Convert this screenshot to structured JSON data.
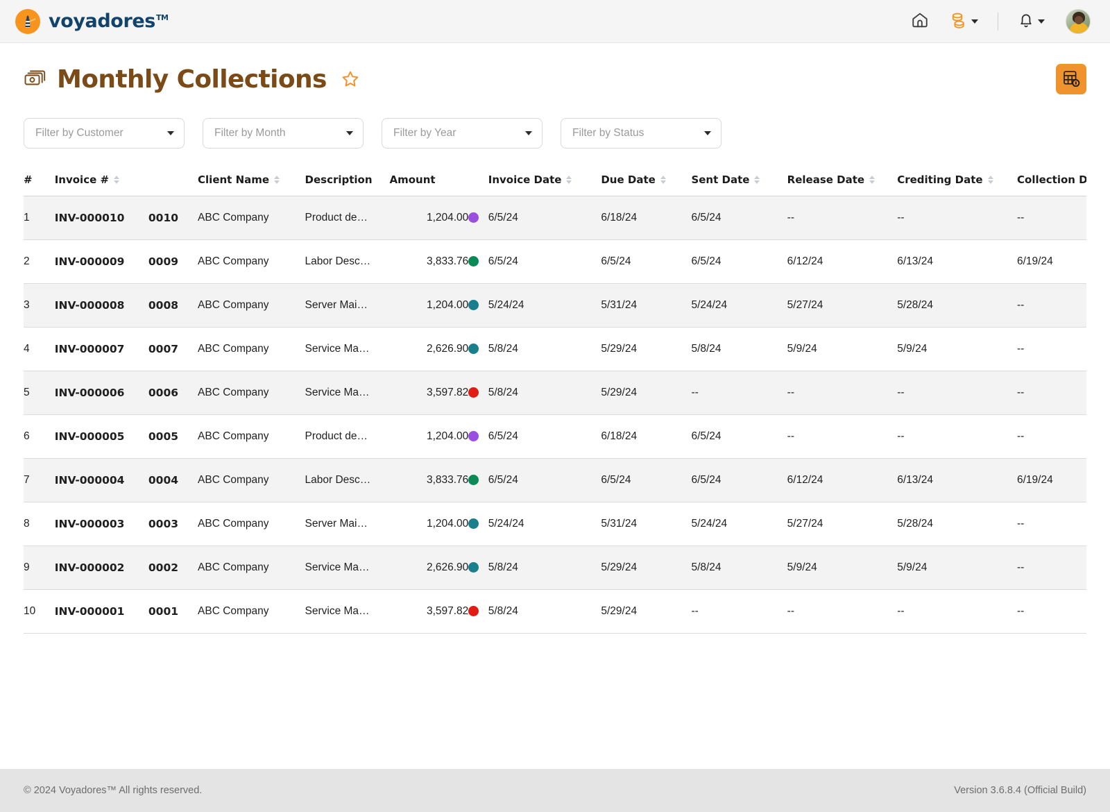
{
  "brand": {
    "name": "voyadores",
    "tm": "TM",
    "logo_icon": "lighthouse-icon",
    "accent_color": "#F7941D",
    "wordmark_color": "#12436B"
  },
  "topnav": {
    "home_icon": "home-icon",
    "billing_icon": "coins-stack-icon",
    "notifications_icon": "bell-icon",
    "avatar_icon": "user-avatar"
  },
  "header": {
    "title": "Monthly Collections",
    "title_icon": "money-bills-icon",
    "favorite_icon": "star-icon",
    "title_color": "#7A4A17",
    "action_button_icon": "calculator-money-icon",
    "action_button_color": "#F1932C"
  },
  "filters": [
    {
      "name": "customer",
      "placeholder": "Filter by Customer",
      "value": ""
    },
    {
      "name": "month",
      "placeholder": "Filter by Month",
      "value": ""
    },
    {
      "name": "year",
      "placeholder": "Filter by Year",
      "value": ""
    },
    {
      "name": "status",
      "placeholder": "Filter by Status",
      "value": ""
    }
  ],
  "table": {
    "columns": [
      {
        "key": "num",
        "label": "#",
        "sortable": false
      },
      {
        "key": "invoice",
        "label": "Invoice #",
        "sortable": true
      },
      {
        "key": "code",
        "label": "",
        "sortable": false
      },
      {
        "key": "client",
        "label": "Client Name",
        "sortable": true
      },
      {
        "key": "desc",
        "label": "Description",
        "sortable": false
      },
      {
        "key": "amount",
        "label": "Amount",
        "sortable": false
      },
      {
        "key": "dot",
        "label": "",
        "sortable": false
      },
      {
        "key": "invdate",
        "label": "Invoice Date",
        "sortable": true
      },
      {
        "key": "duedate",
        "label": "Due Date",
        "sortable": true
      },
      {
        "key": "sent",
        "label": "Sent Date",
        "sortable": true
      },
      {
        "key": "release",
        "label": "Release Date",
        "sortable": true
      },
      {
        "key": "credit",
        "label": "Crediting Date",
        "sortable": true
      },
      {
        "key": "collect",
        "label": "Collection Date",
        "sortable": false
      }
    ],
    "status_colors": {
      "purple": "#9B4FE0",
      "green": "#0C8A56",
      "teal": "#1A7F8C",
      "red": "#E31B15"
    },
    "rows": [
      {
        "num": "1",
        "invoice": "INV-000010",
        "code": "0010",
        "client": "ABC Company",
        "desc": "Product de…",
        "amount": "1,204.00",
        "status": "purple",
        "invdate": "6/5/24",
        "duedate": "6/18/24",
        "sent": "6/5/24",
        "release": "--",
        "credit": "--",
        "collect": "--"
      },
      {
        "num": "2",
        "invoice": "INV-000009",
        "code": "0009",
        "client": "ABC Company",
        "desc": "Labor Desc…",
        "amount": "3,833.76",
        "status": "green",
        "invdate": "6/5/24",
        "duedate": "6/5/24",
        "sent": "6/5/24",
        "release": "6/12/24",
        "credit": "6/13/24",
        "collect": "6/19/24"
      },
      {
        "num": "3",
        "invoice": "INV-000008",
        "code": "0008",
        "client": "ABC Company",
        "desc": "Server Mai…",
        "amount": "1,204.00",
        "status": "teal",
        "invdate": "5/24/24",
        "duedate": "5/31/24",
        "sent": "5/24/24",
        "release": "5/27/24",
        "credit": "5/28/24",
        "collect": "--"
      },
      {
        "num": "4",
        "invoice": "INV-000007",
        "code": "0007",
        "client": "ABC Company",
        "desc": "Service Ma…",
        "amount": "2,626.90",
        "status": "teal",
        "invdate": "5/8/24",
        "duedate": "5/29/24",
        "sent": "5/8/24",
        "release": "5/9/24",
        "credit": "5/9/24",
        "collect": "--"
      },
      {
        "num": "5",
        "invoice": "INV-000006",
        "code": "0006",
        "client": "ABC Company",
        "desc": "Service Ma…",
        "amount": "3,597.82",
        "status": "red",
        "invdate": "5/8/24",
        "duedate": "5/29/24",
        "sent": "--",
        "release": "--",
        "credit": "--",
        "collect": "--"
      },
      {
        "num": "6",
        "invoice": "INV-000005",
        "code": "0005",
        "client": "ABC Company",
        "desc": "Product de…",
        "amount": "1,204.00",
        "status": "purple",
        "invdate": "6/5/24",
        "duedate": "6/18/24",
        "sent": "6/5/24",
        "release": "--",
        "credit": "--",
        "collect": "--"
      },
      {
        "num": "7",
        "invoice": "INV-000004",
        "code": "0004",
        "client": "ABC Company",
        "desc": "Labor Desc…",
        "amount": "3,833.76",
        "status": "green",
        "invdate": "6/5/24",
        "duedate": "6/5/24",
        "sent": "6/5/24",
        "release": "6/12/24",
        "credit": "6/13/24",
        "collect": "6/19/24"
      },
      {
        "num": "8",
        "invoice": "INV-000003",
        "code": "0003",
        "client": "ABC Company",
        "desc": "Server Mai…",
        "amount": "1,204.00",
        "status": "teal",
        "invdate": "5/24/24",
        "duedate": "5/31/24",
        "sent": "5/24/24",
        "release": "5/27/24",
        "credit": "5/28/24",
        "collect": "--"
      },
      {
        "num": "9",
        "invoice": "INV-000002",
        "code": "0002",
        "client": "ABC Company",
        "desc": "Service Ma…",
        "amount": "2,626.90",
        "status": "teal",
        "invdate": "5/8/24",
        "duedate": "5/29/24",
        "sent": "5/8/24",
        "release": "5/9/24",
        "credit": "5/9/24",
        "collect": "--"
      },
      {
        "num": "10",
        "invoice": "INV-000001",
        "code": "0001",
        "client": "ABC Company",
        "desc": "Service Ma…",
        "amount": "3,597.82",
        "status": "red",
        "invdate": "5/8/24",
        "duedate": "5/29/24",
        "sent": "--",
        "release": "--",
        "credit": "--",
        "collect": "--"
      }
    ]
  },
  "footer": {
    "copyright": "© 2024 Voyadores™ All rights reserved.",
    "version": "Version 3.6.8.4 (Official Build)"
  }
}
